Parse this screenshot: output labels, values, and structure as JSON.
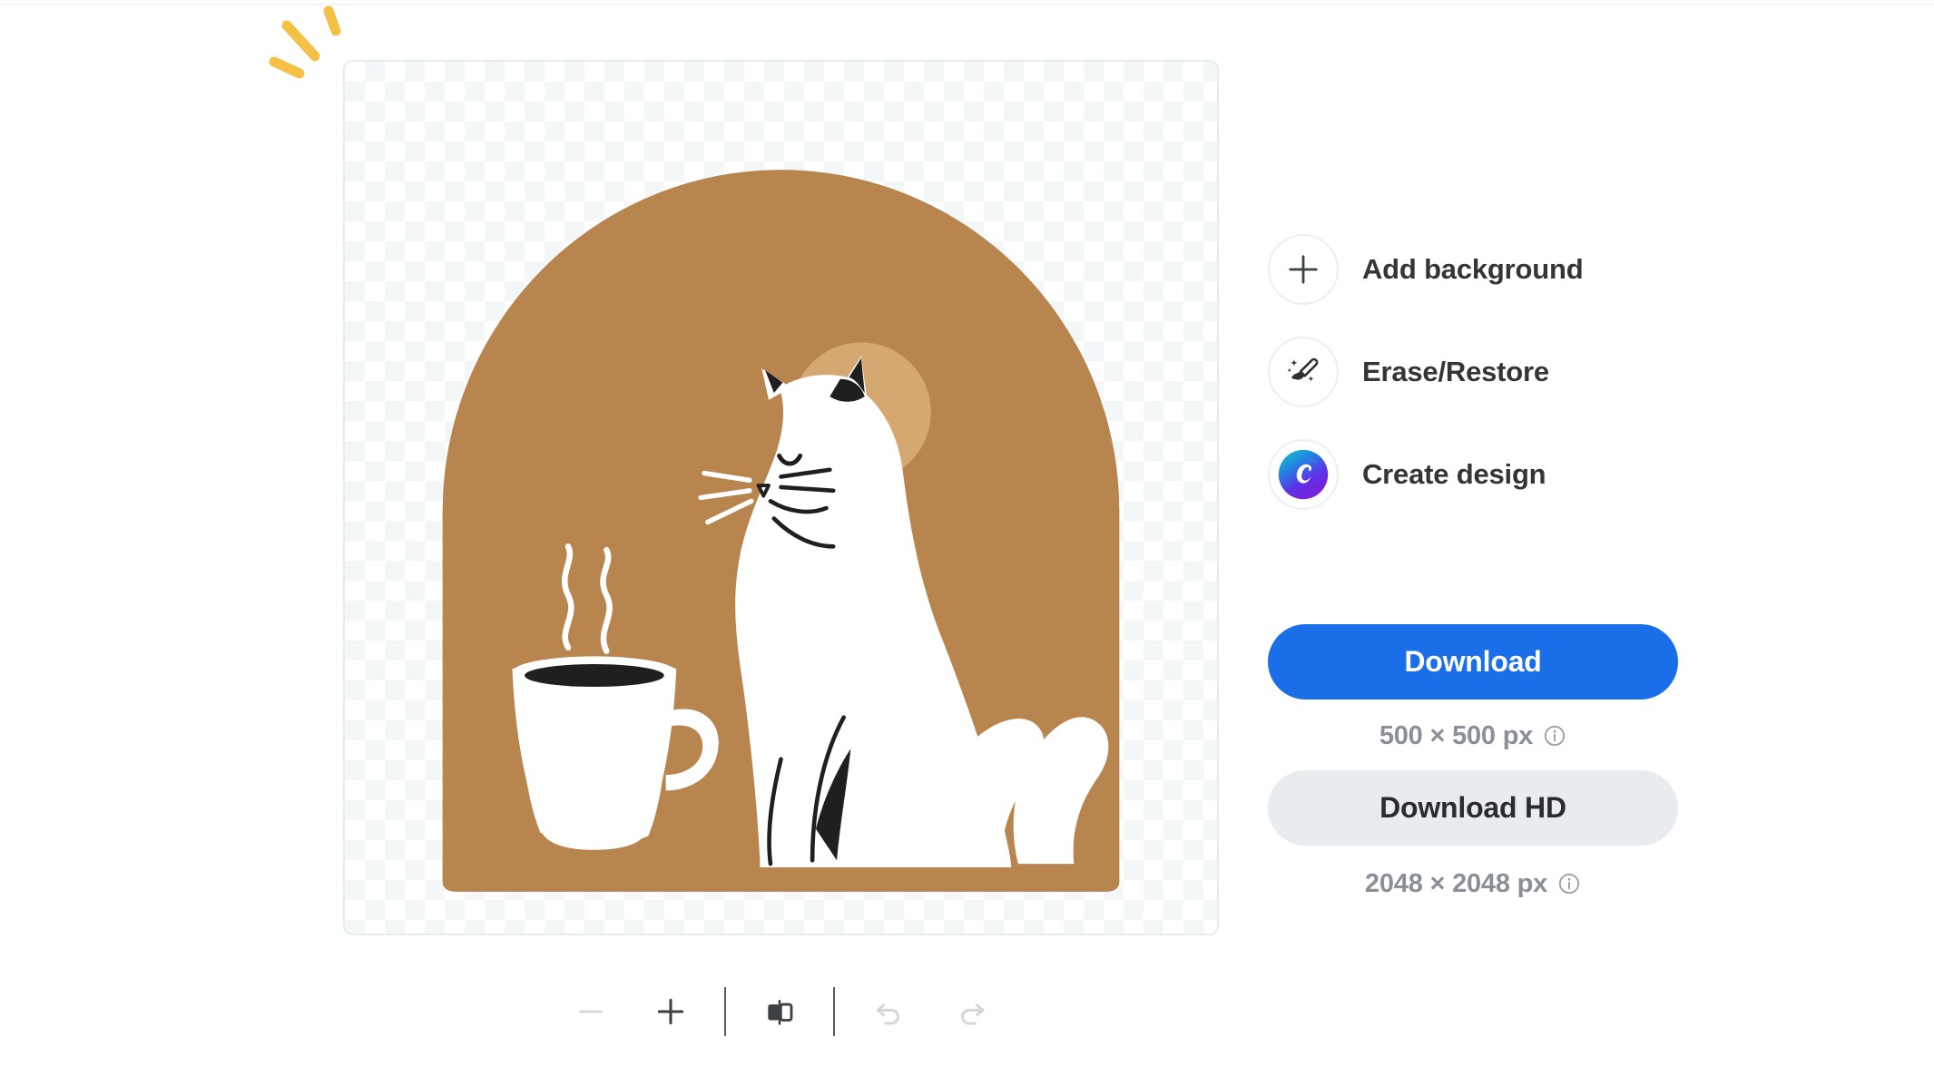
{
  "app": {
    "kind": "background-remover-editor",
    "colors": {
      "accent_blue": "#1a6fe8",
      "secondary_gray": "#e9ecef",
      "sparkle_yellow": "#f5c046",
      "artwork_dome": "#b8854f",
      "artwork_moon": "#d6a871",
      "artwork_cat": "#ffffff",
      "artwork_ink": "#1f1f1f",
      "text_dark": "#333538",
      "text_muted": "#8a8f98",
      "ring_border": "#eceef0",
      "canvas_border": "#e6ecef"
    }
  },
  "canvas": {
    "name": "image-preview-canvas",
    "transparency": "checkerboard",
    "artwork": {
      "title": "cat-with-coffee-cup",
      "description": "White cat sitting beside a steaming coffee mug on a tan dome background with a lighter circle",
      "elements": [
        "dome",
        "moon-circle",
        "cat",
        "coffee-mug",
        "steam"
      ]
    }
  },
  "toolbar": {
    "items": [
      {
        "name": "zoom-out-button",
        "icon": "minus-icon",
        "label": "Zoom out",
        "enabled": false
      },
      {
        "name": "zoom-in-button",
        "icon": "plus-icon",
        "label": "Zoom in",
        "enabled": true
      },
      {
        "name": "compare-toggle-button",
        "icon": "split-compare-icon",
        "label": "Compare",
        "enabled": true
      },
      {
        "name": "undo-button",
        "icon": "undo-arrow-icon",
        "label": "Undo",
        "enabled": false
      },
      {
        "name": "redo-button",
        "icon": "redo-arrow-icon",
        "label": "Redo",
        "enabled": false
      }
    ]
  },
  "side_panel": {
    "actions": [
      {
        "label": "Add background",
        "icon": "plus-icon"
      },
      {
        "label": "Erase/Restore",
        "icon": "magic-brush-icon"
      },
      {
        "label": "Create design",
        "icon": "canva-logo-icon"
      }
    ]
  },
  "download": {
    "primary_label": "Download",
    "primary_size": "500 × 500 px",
    "primary_info_icon": "info-icon",
    "hd_label": "Download HD",
    "hd_size": "2048 × 2048 px",
    "hd_info_icon": "info-icon"
  }
}
